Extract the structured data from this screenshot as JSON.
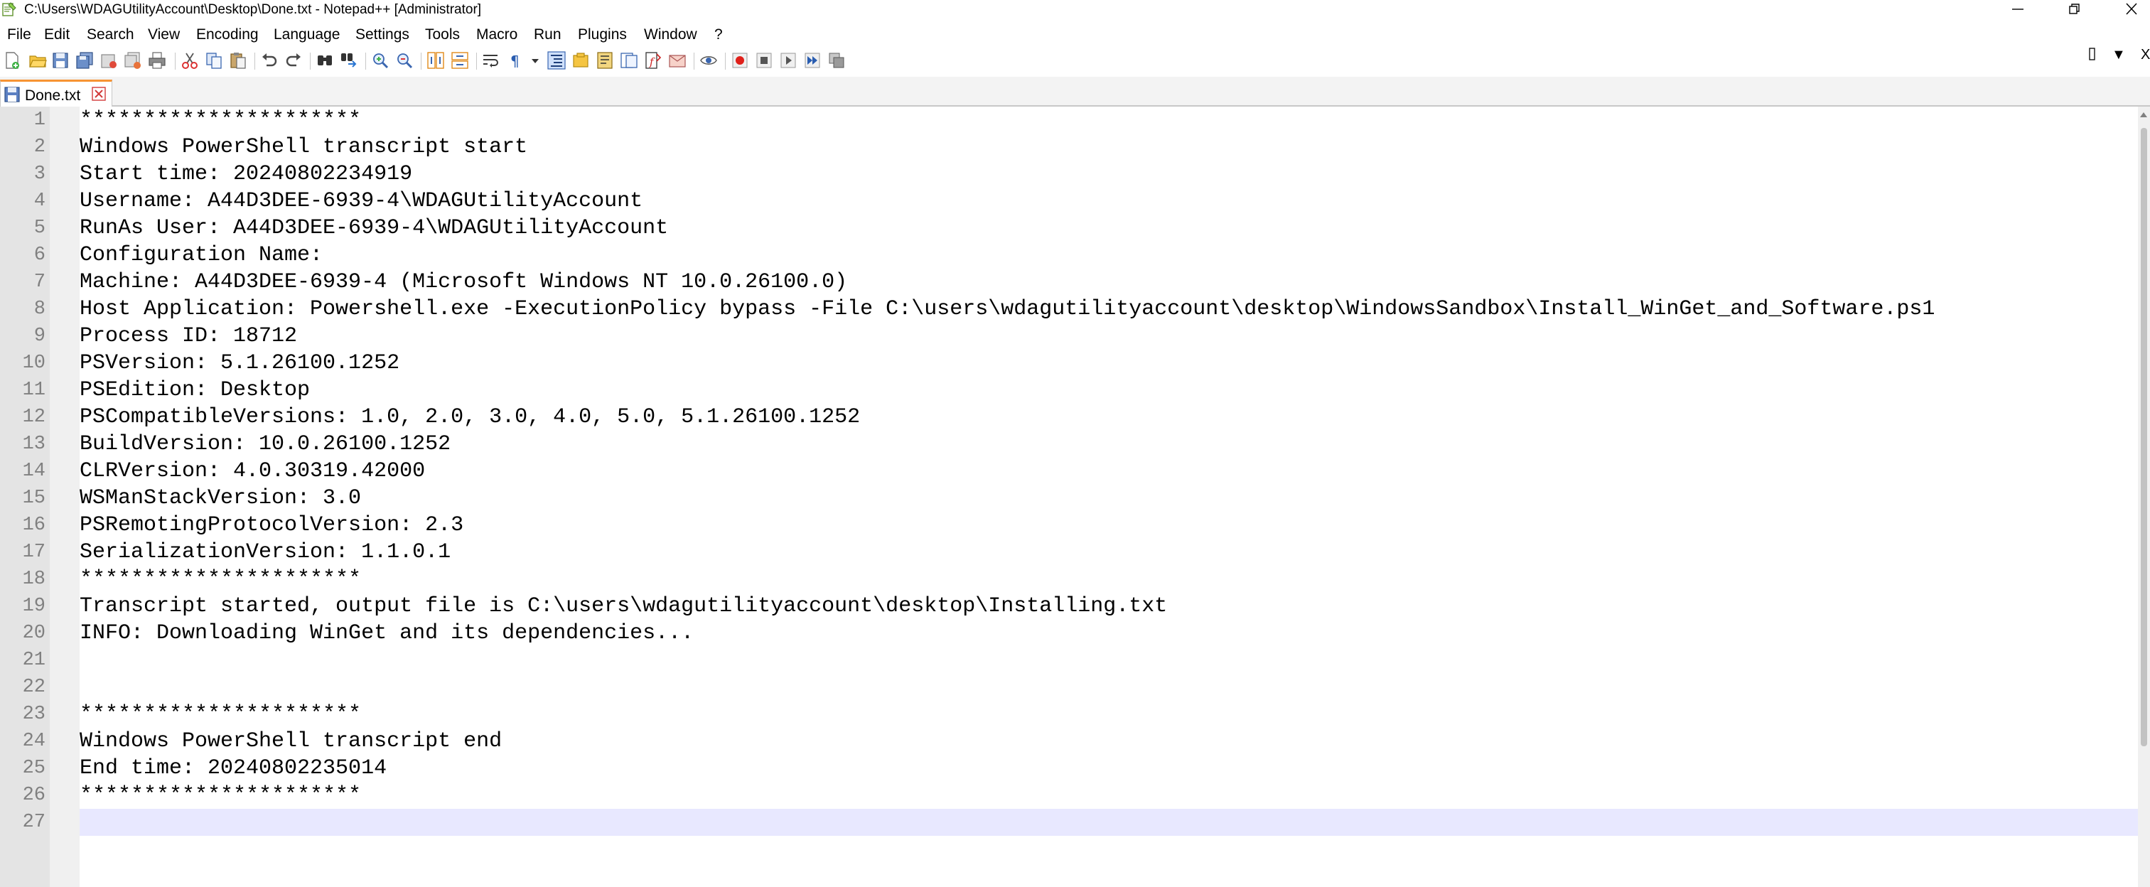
{
  "window": {
    "title": "C:\\Users\\WDAGUtilityAccount\\Desktop\\Done.txt - Notepad++ [Administrator]"
  },
  "menu": {
    "items": [
      "File",
      "Edit",
      "Search",
      "View",
      "Encoding",
      "Language",
      "Settings",
      "Tools",
      "Macro",
      "Run",
      "Plugins",
      "Window",
      "?"
    ],
    "right_down_arrow": "▼",
    "right_close": "X"
  },
  "toolbar": {
    "icons": [
      "new-file-icon",
      "open-file-icon",
      "save-icon",
      "save-all-icon",
      "close-icon",
      "close-all-icon",
      "print-icon",
      "cut-icon",
      "copy-icon",
      "paste-icon",
      "undo-icon",
      "redo-icon",
      "find-icon",
      "replace-icon",
      "zoom-in-icon",
      "zoom-out-icon",
      "sync-vertical-icon",
      "sync-horizontal-icon",
      "word-wrap-icon",
      "show-all-chars-icon",
      "indent-guide-icon",
      "user-defined-language-icon",
      "document-map-icon",
      "function-list-icon",
      "folder-as-workspace-icon",
      "monitoring-icon",
      "record-macro-icon",
      "stop-macro-icon",
      "play-macro-icon",
      "run-macro-multiple-icon",
      "save-macro-icon"
    ]
  },
  "tabs": [
    {
      "label": "Done.txt"
    }
  ],
  "editor": {
    "current_line": 27,
    "lines": [
      {
        "num": "1",
        "text": "**********************"
      },
      {
        "num": "2",
        "text": "Windows PowerShell transcript start"
      },
      {
        "num": "3",
        "text": "Start time: 20240802234919"
      },
      {
        "num": "4",
        "text": "Username: A44D3DEE-6939-4\\WDAGUtilityAccount"
      },
      {
        "num": "5",
        "text": "RunAs User: A44D3DEE-6939-4\\WDAGUtilityAccount"
      },
      {
        "num": "6",
        "text": "Configuration Name:"
      },
      {
        "num": "7",
        "text": "Machine: A44D3DEE-6939-4 (Microsoft Windows NT 10.0.26100.0)"
      },
      {
        "num": "8",
        "text": "Host Application: Powershell.exe -ExecutionPolicy bypass -File C:\\users\\wdagutilityaccount\\desktop\\WindowsSandbox\\Install_WinGet_and_Software.ps1"
      },
      {
        "num": "9",
        "text": "Process ID: 18712"
      },
      {
        "num": "10",
        "text": "PSVersion: 5.1.26100.1252"
      },
      {
        "num": "11",
        "text": "PSEdition: Desktop"
      },
      {
        "num": "12",
        "text": "PSCompatibleVersions: 1.0, 2.0, 3.0, 4.0, 5.0, 5.1.26100.1252"
      },
      {
        "num": "13",
        "text": "BuildVersion: 10.0.26100.1252"
      },
      {
        "num": "14",
        "text": "CLRVersion: 4.0.30319.42000"
      },
      {
        "num": "15",
        "text": "WSManStackVersion: 3.0"
      },
      {
        "num": "16",
        "text": "PSRemotingProtocolVersion: 2.3"
      },
      {
        "num": "17",
        "text": "SerializationVersion: 1.1.0.1"
      },
      {
        "num": "18",
        "text": "**********************"
      },
      {
        "num": "19",
        "text": "Transcript started, output file is C:\\users\\wdagutilityaccount\\desktop\\Installing.txt"
      },
      {
        "num": "20",
        "text": "INFO: Downloading WinGet and its dependencies..."
      },
      {
        "num": "21",
        "text": ""
      },
      {
        "num": "22",
        "text": ""
      },
      {
        "num": "23",
        "text": "**********************"
      },
      {
        "num": "24",
        "text": "Windows PowerShell transcript end"
      },
      {
        "num": "25",
        "text": "End time: 20240802235014"
      },
      {
        "num": "26",
        "text": "**********************"
      },
      {
        "num": "27",
        "text": ""
      }
    ]
  }
}
